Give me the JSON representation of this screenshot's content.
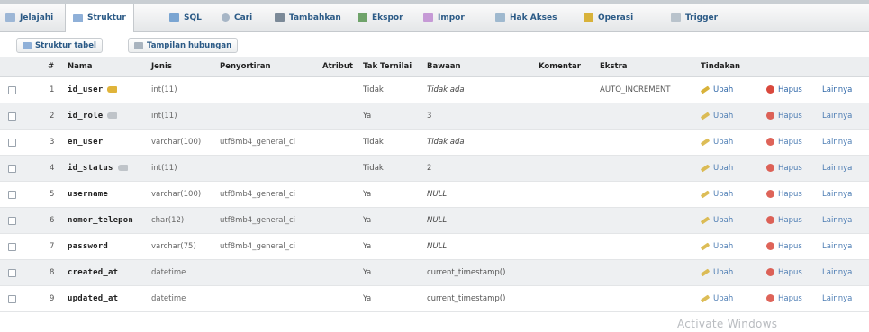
{
  "tabs": [
    {
      "label": "Jelajahi",
      "icon": "table-icon"
    },
    {
      "label": "Struktur",
      "icon": "structure-icon"
    },
    {
      "label": "SQL",
      "icon": "sql-icon"
    },
    {
      "label": "Cari",
      "icon": "search-icon"
    },
    {
      "label": "Tambahkan",
      "icon": "insert-icon"
    },
    {
      "label": "Ekspor",
      "icon": "export-icon"
    },
    {
      "label": "Impor",
      "icon": "import-icon"
    },
    {
      "label": "Hak Akses",
      "icon": "privileges-icon"
    },
    {
      "label": "Operasi",
      "icon": "operations-icon"
    },
    {
      "label": "Trigger",
      "icon": "trigger-icon"
    }
  ],
  "active_tab": "Struktur",
  "subtabs": [
    {
      "label": "Struktur tabel",
      "icon": "structure-icon"
    },
    {
      "label": "Tampilan hubungan",
      "icon": "relation-icon"
    }
  ],
  "columns": [
    "#",
    "Nama",
    "Jenis",
    "Penyortiran",
    "Atribut",
    "Tak Ternilai",
    "Bawaan",
    "Komentar",
    "Ekstra",
    "Tindakan"
  ],
  "actions": {
    "edit": "Ubah",
    "drop": "Hapus",
    "more": "Lainnya"
  },
  "rows": [
    {
      "num": "1",
      "name": "id_user",
      "key": "primary",
      "type": "int(11)",
      "collation": "",
      "null": "Tidak",
      "default": "Tidak ada",
      "extra": "AUTO_INCREMENT"
    },
    {
      "num": "2",
      "name": "id_role",
      "key": "index",
      "type": "int(11)",
      "collation": "",
      "null": "Ya",
      "default": "3",
      "extra": ""
    },
    {
      "num": "3",
      "name": "en_user",
      "key": "",
      "type": "varchar(100)",
      "collation": "utf8mb4_general_ci",
      "null": "Tidak",
      "default": "Tidak ada",
      "extra": ""
    },
    {
      "num": "4",
      "name": "id_status",
      "key": "index",
      "type": "int(11)",
      "collation": "",
      "null": "Tidak",
      "default": "2",
      "extra": ""
    },
    {
      "num": "5",
      "name": "username",
      "key": "",
      "type": "varchar(100)",
      "collation": "utf8mb4_general_ci",
      "null": "Ya",
      "default": "NULL",
      "extra": ""
    },
    {
      "num": "6",
      "name": "nomor_telepon",
      "key": "",
      "type": "char(12)",
      "collation": "utf8mb4_general_ci",
      "null": "Ya",
      "default": "NULL",
      "extra": ""
    },
    {
      "num": "7",
      "name": "password",
      "key": "",
      "type": "varchar(75)",
      "collation": "utf8mb4_general_ci",
      "null": "Ya",
      "default": "NULL",
      "extra": ""
    },
    {
      "num": "8",
      "name": "created_at",
      "key": "",
      "type": "datetime",
      "collation": "",
      "null": "Ya",
      "default": "current_timestamp()",
      "extra": ""
    },
    {
      "num": "9",
      "name": "updated_at",
      "key": "",
      "type": "datetime",
      "collation": "",
      "null": "Ya",
      "default": "current_timestamp()",
      "extra": ""
    }
  ],
  "watermark": "Activate Windows",
  "colors": {
    "link": "#3068a8",
    "tab_text": "#2b5a86",
    "header_bg": "#eceef0",
    "alt_row": "#eef0f2",
    "drop_icon": "#d9493d",
    "primary_key": "#e0b43a"
  }
}
